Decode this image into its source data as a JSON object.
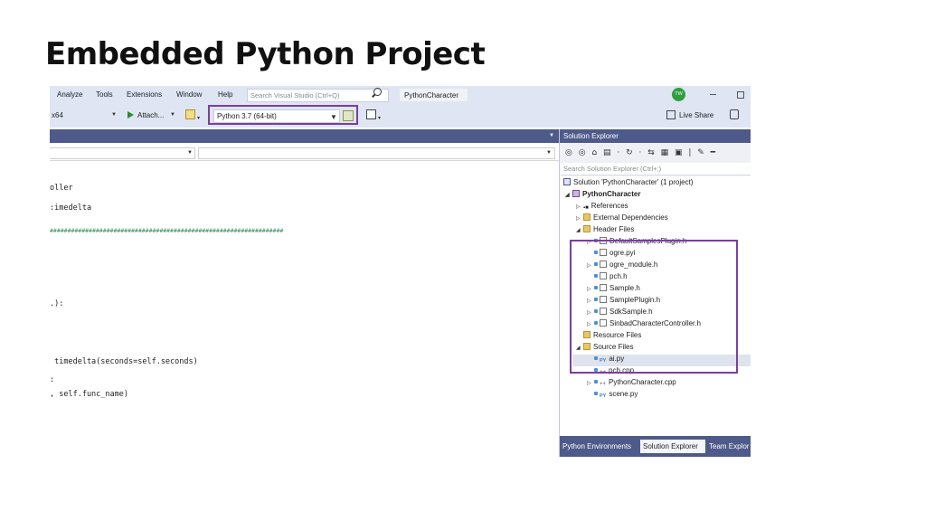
{
  "slide": {
    "title": "Embedded Python Project"
  },
  "menubar": {
    "items": [
      "Analyze",
      "Tools",
      "Extensions",
      "Window",
      "Help"
    ],
    "search_placeholder": "Search Visual Studio (Ctrl+Q)",
    "solution_name": "PythonCharacter",
    "user_initials": "TW"
  },
  "toolbar": {
    "platform": "x64",
    "attach_label": "Attach...",
    "python_env": "Python 3.7 (64-bit)",
    "live_share": "Live Share"
  },
  "editor": {
    "lines": [
      "oller",
      ":imedelta",
      "##################################################################",
      ".):",
      " timedelta(seconds=self.seconds)",
      ":",
      ", self.func_name)"
    ]
  },
  "solution_explorer": {
    "title": "Solution Explorer",
    "search_placeholder": "Search Solution Explorer (Ctrl+;)",
    "tree": [
      {
        "label": "Solution 'PythonCharacter' (1 project)",
        "kind": "sol"
      },
      {
        "label": "PythonCharacter",
        "kind": "proj"
      },
      {
        "label": "References",
        "kind": "ref"
      },
      {
        "label": "External Dependencies",
        "kind": "ext"
      },
      {
        "label": "Header Files",
        "kind": "folder"
      },
      {
        "label": "DefaultSamplesPlugin.h",
        "kind": "file"
      },
      {
        "label": "ogre.pyi",
        "kind": "file"
      },
      {
        "label": "ogre_module.h",
        "kind": "file"
      },
      {
        "label": "pch.h",
        "kind": "file"
      },
      {
        "label": "Sample.h",
        "kind": "file"
      },
      {
        "label": "SamplePlugin.h",
        "kind": "file"
      },
      {
        "label": "SdkSample.h",
        "kind": "file"
      },
      {
        "label": "SinbadCharacterController.h",
        "kind": "file"
      },
      {
        "label": "Resource Files",
        "kind": "folder"
      },
      {
        "label": "Source Files",
        "kind": "folder"
      },
      {
        "label": "ai.py",
        "kind": "py"
      },
      {
        "label": "pch.cpp",
        "kind": "cpp"
      },
      {
        "label": "PythonCharacter.cpp",
        "kind": "cpp"
      },
      {
        "label": "scene.py",
        "kind": "py"
      }
    ],
    "tabs": [
      "Python Environments",
      "Solution Explorer",
      "Team Explor"
    ]
  },
  "colors": {
    "highlight": "#7a3fa0",
    "title_bar": "#4e5a8a",
    "chrome": "#dfe5f3"
  }
}
